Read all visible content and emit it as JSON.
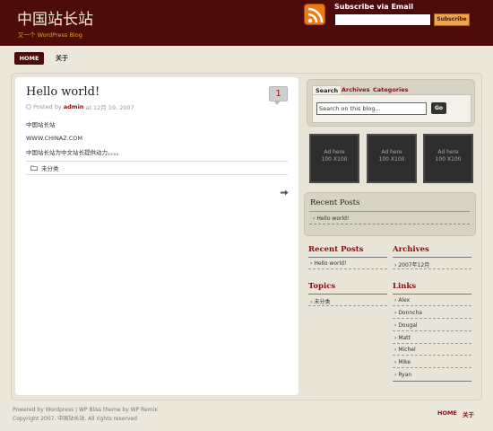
{
  "header": {
    "site_title": "中国站长站",
    "tagline": "又一个 WordPress Blog",
    "subscribe_label": "Subscribe via Email",
    "subscribe_button": "Subscribe",
    "rss_icon": "rss-feed-icon"
  },
  "nav": {
    "home": "HOME",
    "about": "关于"
  },
  "post": {
    "title": "Hello world!",
    "comment_count": "1",
    "meta_prefix": "Posted by",
    "author": "admin",
    "meta_date": "at 12月 19, 2007",
    "lines": [
      "中国站长站",
      "WWW.CHINAZ.COM",
      "中国站长站为中文站长提供动力。。。。"
    ],
    "category": "未分类"
  },
  "sidebar": {
    "tabs": [
      "Search",
      "Archives",
      "Categories"
    ],
    "search_placeholder": "Search on this blog...",
    "go_label": "Go",
    "ads": [
      {
        "line1": "Ad here",
        "line2": "100 X100"
      },
      {
        "line1": "Ad here",
        "line2": "100 X100"
      },
      {
        "line1": "Ad here",
        "line2": "100 X100"
      }
    ],
    "recent_box_title": "Recent Posts",
    "recent_box_item": "Hello world!",
    "recent_title": "Recent Posts",
    "recent_item": "Hello world!",
    "archives_title": "Archives",
    "archives_item": "2007年12月",
    "topics_title": "Topics",
    "topics_item": "未分类",
    "links_title": "Links",
    "links": [
      "Alex",
      "Donncha",
      "Dougal",
      "Matt",
      "Michel",
      "Mike",
      "Ryan"
    ]
  },
  "footer": {
    "line1": "Powered by Wordpress | WP Bliss theme by WP Remix",
    "line2": "Copyright 2007. 中国站长站. All rights reserved",
    "home": "HOME",
    "about": "关于"
  },
  "colors": {
    "accent": "#4d0b0a",
    "link": "#8a0d0d",
    "rss": "#ee7a14",
    "button": "#f1a54a"
  }
}
